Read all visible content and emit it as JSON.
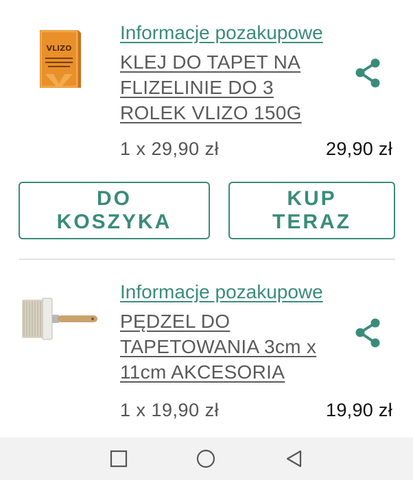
{
  "items": [
    {
      "info_link": "Informacje pozakupowe",
      "title": "KLEJ DO TAPET NA FLIZELINIE DO 3 ROLEK VLIZO 150G",
      "quantity_price": "1 x 29,90 zł",
      "total": "29,90 zł",
      "thumb_brand": "VLIZO",
      "thumb_text": "SPECJALNY KLEJ NA ŚCIANĘ",
      "image_icon": "glue-box-icon"
    },
    {
      "info_link": "Informacje pozakupowe",
      "title": "PĘDZEL DO TAPETOWANIA 3cm x 11cm AKCESORIA",
      "quantity_price": "1 x 19,90 zł",
      "total": "19,90 zł",
      "image_icon": "brush-icon"
    }
  ],
  "actions": {
    "add_to_cart": "DO KOSZYKA",
    "buy_now": "KUP TERAZ"
  },
  "icons": {
    "share": "share-icon",
    "nav_recent": "square-icon",
    "nav_home": "circle-icon",
    "nav_back": "triangle-back-icon"
  },
  "colors": {
    "accent": "#3a8c7a",
    "text": "#5a5a5a",
    "price": "#111111",
    "navbar": "#f2f2f2"
  }
}
